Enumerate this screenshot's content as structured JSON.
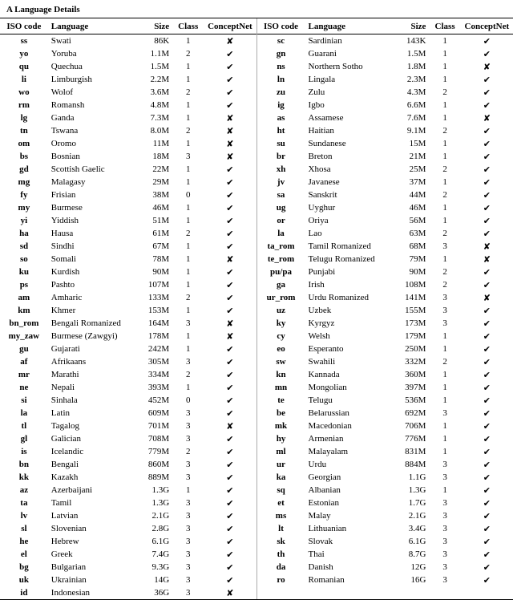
{
  "title": "A   Language Details",
  "headers": {
    "iso": "ISO code",
    "lang": "Language",
    "size": "Size",
    "cls": "Class",
    "cn": "ConceptNet",
    "cn_short": "ConceptNet"
  },
  "left": [
    {
      "iso": "ss",
      "lang": "Swati",
      "size": "86K",
      "cls": "1",
      "cn": false
    },
    {
      "iso": "yo",
      "lang": "Yoruba",
      "size": "1.1M",
      "cls": "2",
      "cn": true
    },
    {
      "iso": "qu",
      "lang": "Quechua",
      "size": "1.5M",
      "cls": "1",
      "cn": true
    },
    {
      "iso": "li",
      "lang": "Limburgish",
      "size": "2.2M",
      "cls": "1",
      "cn": true
    },
    {
      "iso": "wo",
      "lang": "Wolof",
      "size": "3.6M",
      "cls": "2",
      "cn": true
    },
    {
      "iso": "rm",
      "lang": "Romansh",
      "size": "4.8M",
      "cls": "1",
      "cn": true
    },
    {
      "iso": "lg",
      "lang": "Ganda",
      "size": "7.3M",
      "cls": "1",
      "cn": false
    },
    {
      "iso": "tn",
      "lang": "Tswana",
      "size": "8.0M",
      "cls": "2",
      "cn": false
    },
    {
      "iso": "om",
      "lang": "Oromo",
      "size": "11M",
      "cls": "1",
      "cn": false
    },
    {
      "iso": "bs",
      "lang": "Bosnian",
      "size": "18M",
      "cls": "3",
      "cn": false
    },
    {
      "iso": "gd",
      "lang": "Scottish Gaelic",
      "size": "22M",
      "cls": "1",
      "cn": true
    },
    {
      "iso": "mg",
      "lang": "Malagasy",
      "size": "29M",
      "cls": "1",
      "cn": true
    },
    {
      "iso": "fy",
      "lang": "Frisian",
      "size": "38M",
      "cls": "0",
      "cn": true
    },
    {
      "iso": "my",
      "lang": "Burmese",
      "size": "46M",
      "cls": "1",
      "cn": true
    },
    {
      "iso": "yi",
      "lang": "Yiddish",
      "size": "51M",
      "cls": "1",
      "cn": true
    },
    {
      "iso": "ha",
      "lang": "Hausa",
      "size": "61M",
      "cls": "2",
      "cn": true
    },
    {
      "iso": "sd",
      "lang": "Sindhi",
      "size": "67M",
      "cls": "1",
      "cn": true
    },
    {
      "iso": "so",
      "lang": "Somali",
      "size": "78M",
      "cls": "1",
      "cn": false
    },
    {
      "iso": "ku",
      "lang": "Kurdish",
      "size": "90M",
      "cls": "1",
      "cn": true
    },
    {
      "iso": "ps",
      "lang": "Pashto",
      "size": "107M",
      "cls": "1",
      "cn": true
    },
    {
      "iso": "am",
      "lang": "Amharic",
      "size": "133M",
      "cls": "2",
      "cn": true
    },
    {
      "iso": "km",
      "lang": "Khmer",
      "size": "153M",
      "cls": "1",
      "cn": true
    },
    {
      "iso": "bn_rom",
      "lang": "Bengali Romanized",
      "size": "164M",
      "cls": "3",
      "cn": false
    },
    {
      "iso": "my_zaw",
      "lang": "Burmese (Zawgyi)",
      "size": "178M",
      "cls": "1",
      "cn": false
    },
    {
      "iso": "gu",
      "lang": "Gujarati",
      "size": "242M",
      "cls": "1",
      "cn": true
    },
    {
      "iso": "af",
      "lang": "Afrikaans",
      "size": "305M",
      "cls": "3",
      "cn": true
    },
    {
      "iso": "mr",
      "lang": "Marathi",
      "size": "334M",
      "cls": "2",
      "cn": true
    },
    {
      "iso": "ne",
      "lang": "Nepali",
      "size": "393M",
      "cls": "1",
      "cn": true
    },
    {
      "iso": "si",
      "lang": "Sinhala",
      "size": "452M",
      "cls": "0",
      "cn": true
    },
    {
      "iso": "la",
      "lang": "Latin",
      "size": "609M",
      "cls": "3",
      "cn": true
    },
    {
      "iso": "tl",
      "lang": "Tagalog",
      "size": "701M",
      "cls": "3",
      "cn": false
    },
    {
      "iso": "gl",
      "lang": "Galician",
      "size": "708M",
      "cls": "3",
      "cn": true
    },
    {
      "iso": "is",
      "lang": "Icelandic",
      "size": "779M",
      "cls": "2",
      "cn": true
    },
    {
      "iso": "bn",
      "lang": "Bengali",
      "size": "860M",
      "cls": "3",
      "cn": true
    },
    {
      "iso": "kk",
      "lang": "Kazakh",
      "size": "889M",
      "cls": "3",
      "cn": true
    },
    {
      "iso": "az",
      "lang": "Azerbaijani",
      "size": "1.3G",
      "cls": "1",
      "cn": true
    },
    {
      "iso": "ta",
      "lang": "Tamil",
      "size": "1.3G",
      "cls": "3",
      "cn": true
    },
    {
      "iso": "lv",
      "lang": "Latvian",
      "size": "2.1G",
      "cls": "3",
      "cn": true
    },
    {
      "iso": "sl",
      "lang": "Slovenian",
      "size": "2.8G",
      "cls": "3",
      "cn": true
    },
    {
      "iso": "he",
      "lang": "Hebrew",
      "size": "6.1G",
      "cls": "3",
      "cn": true
    },
    {
      "iso": "el",
      "lang": "Greek",
      "size": "7.4G",
      "cls": "3",
      "cn": true
    },
    {
      "iso": "bg",
      "lang": "Bulgarian",
      "size": "9.3G",
      "cls": "3",
      "cn": true
    },
    {
      "iso": "uk",
      "lang": "Ukrainian",
      "size": "14G",
      "cls": "3",
      "cn": true
    },
    {
      "iso": "id",
      "lang": "Indonesian",
      "size": "36G",
      "cls": "3",
      "cn": false
    }
  ],
  "right": [
    {
      "iso": "sc",
      "lang": "Sardinian",
      "size": "143K",
      "cls": "1",
      "cn": true
    },
    {
      "iso": "gn",
      "lang": "Guarani",
      "size": "1.5M",
      "cls": "1",
      "cn": true
    },
    {
      "iso": "ns",
      "lang": "Northern Sotho",
      "size": "1.8M",
      "cls": "1",
      "cn": false
    },
    {
      "iso": "ln",
      "lang": "Lingala",
      "size": "2.3M",
      "cls": "1",
      "cn": true
    },
    {
      "iso": "zu",
      "lang": "Zulu",
      "size": "4.3M",
      "cls": "2",
      "cn": true
    },
    {
      "iso": "ig",
      "lang": "Igbo",
      "size": "6.6M",
      "cls": "1",
      "cn": true
    },
    {
      "iso": "as",
      "lang": "Assamese",
      "size": "7.6M",
      "cls": "1",
      "cn": false
    },
    {
      "iso": "ht",
      "lang": "Haitian",
      "size": "9.1M",
      "cls": "2",
      "cn": true
    },
    {
      "iso": "su",
      "lang": "Sundanese",
      "size": "15M",
      "cls": "1",
      "cn": true
    },
    {
      "iso": "br",
      "lang": "Breton",
      "size": "21M",
      "cls": "1",
      "cn": true
    },
    {
      "iso": "xh",
      "lang": "Xhosa",
      "size": "25M",
      "cls": "2",
      "cn": true
    },
    {
      "iso": "jv",
      "lang": "Javanese",
      "size": "37M",
      "cls": "1",
      "cn": true
    },
    {
      "iso": "sa",
      "lang": "Sanskrit",
      "size": "44M",
      "cls": "2",
      "cn": true
    },
    {
      "iso": "ug",
      "lang": "Uyghur",
      "size": "46M",
      "cls": "1",
      "cn": true
    },
    {
      "iso": "or",
      "lang": "Oriya",
      "size": "56M",
      "cls": "1",
      "cn": true
    },
    {
      "iso": "la",
      "lang": "Lao",
      "size": "63M",
      "cls": "2",
      "cn": true
    },
    {
      "iso": "ta_rom",
      "lang": "Tamil Romanized",
      "size": "68M",
      "cls": "3",
      "cn": false
    },
    {
      "iso": "te_rom",
      "lang": "Telugu Romanized",
      "size": "79M",
      "cls": "1",
      "cn": false
    },
    {
      "iso": "pu/pa",
      "lang": "Punjabi",
      "size": "90M",
      "cls": "2",
      "cn": true
    },
    {
      "iso": "ga",
      "lang": "Irish",
      "size": "108M",
      "cls": "2",
      "cn": true
    },
    {
      "iso": "ur_rom",
      "lang": "Urdu Romanized",
      "size": "141M",
      "cls": "3",
      "cn": false
    },
    {
      "iso": "uz",
      "lang": "Uzbek",
      "size": "155M",
      "cls": "3",
      "cn": true
    },
    {
      "iso": "ky",
      "lang": "Kyrgyz",
      "size": "173M",
      "cls": "3",
      "cn": true
    },
    {
      "iso": "cy",
      "lang": "Welsh",
      "size": "179M",
      "cls": "1",
      "cn": true
    },
    {
      "iso": "eo",
      "lang": "Esperanto",
      "size": "250M",
      "cls": "1",
      "cn": true
    },
    {
      "iso": "sw",
      "lang": "Swahili",
      "size": "332M",
      "cls": "2",
      "cn": true
    },
    {
      "iso": "kn",
      "lang": "Kannada",
      "size": "360M",
      "cls": "1",
      "cn": true
    },
    {
      "iso": "mn",
      "lang": "Mongolian",
      "size": "397M",
      "cls": "1",
      "cn": true
    },
    {
      "iso": "te",
      "lang": "Telugu",
      "size": "536M",
      "cls": "1",
      "cn": true
    },
    {
      "iso": "be",
      "lang": "Belarussian",
      "size": "692M",
      "cls": "3",
      "cn": true
    },
    {
      "iso": "mk",
      "lang": "Macedonian",
      "size": "706M",
      "cls": "1",
      "cn": true
    },
    {
      "iso": "hy",
      "lang": "Armenian",
      "size": "776M",
      "cls": "1",
      "cn": true
    },
    {
      "iso": "ml",
      "lang": "Malayalam",
      "size": "831M",
      "cls": "1",
      "cn": true
    },
    {
      "iso": "ur",
      "lang": "Urdu",
      "size": "884M",
      "cls": "3",
      "cn": true
    },
    {
      "iso": "ka",
      "lang": "Georgian",
      "size": "1.1G",
      "cls": "3",
      "cn": true
    },
    {
      "iso": "sq",
      "lang": "Albanian",
      "size": "1.3G",
      "cls": "1",
      "cn": true
    },
    {
      "iso": "et",
      "lang": "Estonian",
      "size": "1.7G",
      "cls": "3",
      "cn": true
    },
    {
      "iso": "ms",
      "lang": "Malay",
      "size": "2.1G",
      "cls": "3",
      "cn": true
    },
    {
      "iso": "lt",
      "lang": "Lithuanian",
      "size": "3.4G",
      "cls": "3",
      "cn": true
    },
    {
      "iso": "sk",
      "lang": "Slovak",
      "size": "6.1G",
      "cls": "3",
      "cn": true
    },
    {
      "iso": "th",
      "lang": "Thai",
      "size": "8.7G",
      "cls": "3",
      "cn": true
    },
    {
      "iso": "da",
      "lang": "Danish",
      "size": "12G",
      "cls": "3",
      "cn": true
    },
    {
      "iso": "ro",
      "lang": "Romanian",
      "size": "16G",
      "cls": "3",
      "cn": true
    }
  ],
  "symbols": {
    "tick": "✔",
    "cross": "✘"
  }
}
